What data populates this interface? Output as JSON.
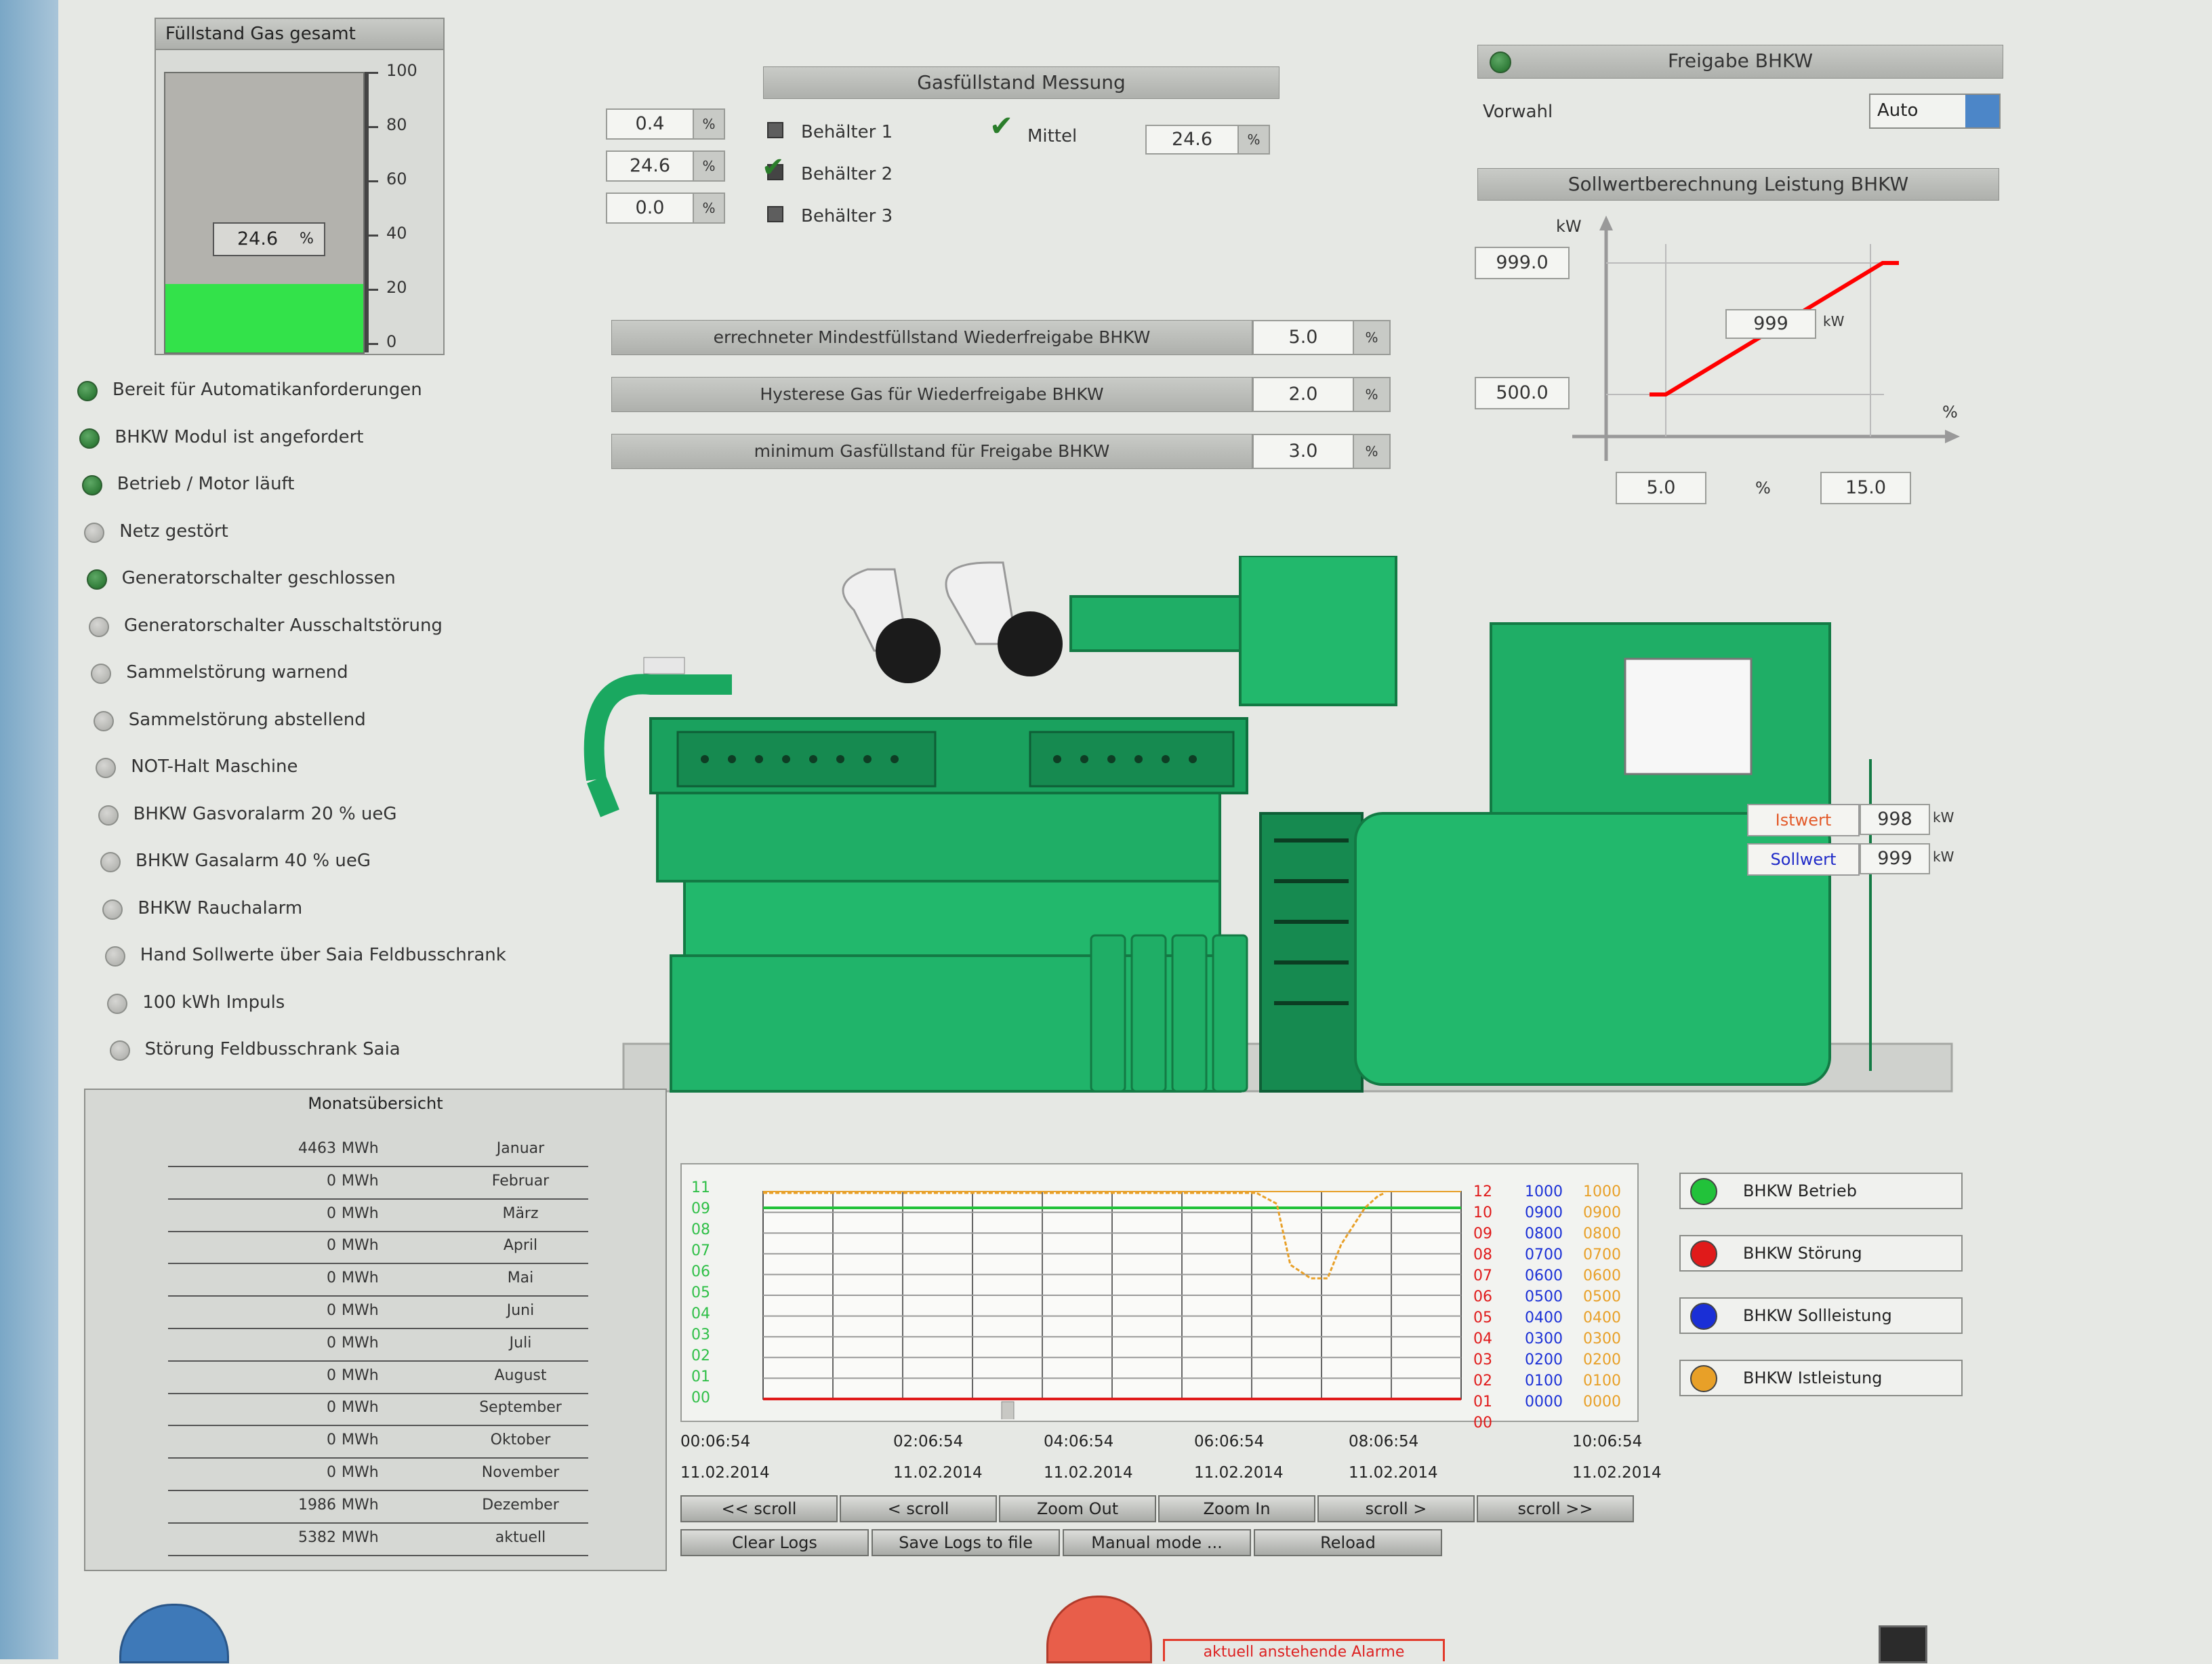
{
  "fill_panel": {
    "title": "Füllstand Gas gesamt",
    "value": "24.6",
    "unit": "%",
    "ticks": [
      "100",
      "80",
      "60",
      "40",
      "20",
      "0"
    ],
    "level": 0.246
  },
  "measurement": {
    "title": "Gasfüllstand Messung",
    "containers": [
      {
        "value": "0.4",
        "unit": "%",
        "label": "Behälter 1",
        "checked": false
      },
      {
        "value": "24.6",
        "unit": "%",
        "label": "Behälter 2",
        "checked": true
      },
      {
        "value": "0.0",
        "unit": "%",
        "label": "Behälter 3",
        "checked": false
      }
    ],
    "mittel_label": "Mittel",
    "mittel_value": "24.6",
    "mittel_unit": "%"
  },
  "settings": [
    {
      "label": "errechneter Mindestfüllstand Wiederfreigabe BHKW",
      "value": "5.0",
      "unit": "%"
    },
    {
      "label": "Hysterese Gas für Wiederfreigabe BHKW",
      "value": "2.0",
      "unit": "%"
    },
    {
      "label": "minimum Gasfüllstand für Freigabe BHKW",
      "value": "3.0",
      "unit": "%"
    }
  ],
  "freigabe": {
    "title": "Freigabe BHKW",
    "vorwahl_label": "Vorwahl",
    "vorwahl_value": "Auto"
  },
  "sollwert_calc": {
    "title": "Sollwertberechnung Leistung BHKW",
    "y_unit": "kW",
    "x_unit": "%",
    "y_high": "999.0",
    "y_low": "500.0",
    "current_value": "999",
    "current_unit": "kW",
    "x_low": "5.0",
    "x_mid_unit": "%",
    "x_high": "15.0"
  },
  "generator": {
    "istwert_label": "Istwert",
    "istwert_value": "998",
    "istwert_unit": "kW",
    "sollwert_label": "Sollwert",
    "sollwert_value": "999",
    "sollwert_unit": "kW"
  },
  "status": [
    {
      "label": "Bereit für Automatikanforderungen",
      "on": true
    },
    {
      "label": "BHKW Modul ist angefordert",
      "on": true
    },
    {
      "label": "Betrieb / Motor läuft",
      "on": true
    },
    {
      "label": "Netz gestört",
      "on": false
    },
    {
      "label": "Generatorschalter geschlossen",
      "on": true
    },
    {
      "label": "Generatorschalter Ausschaltstörung",
      "on": false
    },
    {
      "label": "Sammelstörung warnend",
      "on": false
    },
    {
      "label": "Sammelstörung abstellend",
      "on": false
    },
    {
      "label": "NOT-Halt Maschine",
      "on": false
    },
    {
      "label": "BHKW Gasvoralarm 20 % ueG",
      "on": false
    },
    {
      "label": "BHKW Gasalarm 40 % ueG",
      "on": false
    },
    {
      "label": "BHKW Rauchalarm",
      "on": false
    },
    {
      "label": "Hand Sollwerte über Saia Feldbusschrank",
      "on": false
    },
    {
      "label": "100 kWh Impuls",
      "on": false
    },
    {
      "label": "Störung Feldbusschrank Saia",
      "on": false
    }
  ],
  "monthly": {
    "title": "Monatsübersicht",
    "rows": [
      {
        "value": "4463",
        "unit": "MWh",
        "month": "Januar"
      },
      {
        "value": "0",
        "unit": "MWh",
        "month": "Februar"
      },
      {
        "value": "0",
        "unit": "MWh",
        "month": "März"
      },
      {
        "value": "0",
        "unit": "MWh",
        "month": "April"
      },
      {
        "value": "0",
        "unit": "MWh",
        "month": "Mai"
      },
      {
        "value": "0",
        "unit": "MWh",
        "month": "Juni"
      },
      {
        "value": "0",
        "unit": "MWh",
        "month": "Juli"
      },
      {
        "value": "0",
        "unit": "MWh",
        "month": "August"
      },
      {
        "value": "0",
        "unit": "MWh",
        "month": "September"
      },
      {
        "value": "0",
        "unit": "MWh",
        "month": "Oktober"
      },
      {
        "value": "0",
        "unit": "MWh",
        "month": "November"
      },
      {
        "value": "1986",
        "unit": "MWh",
        "month": "Dezember"
      },
      {
        "value": "5382",
        "unit": "MWh",
        "month": "aktuell"
      }
    ]
  },
  "trend": {
    "left_ticks": [
      "11",
      "09",
      "08",
      "07",
      "06",
      "05",
      "04",
      "03",
      "02",
      "01",
      "00"
    ],
    "red_ticks": [
      "12",
      "10",
      "09",
      "08",
      "07",
      "06",
      "05",
      "04",
      "03",
      "02",
      "01",
      "00"
    ],
    "blue_ticks": [
      "1000",
      "0900",
      "0800",
      "0700",
      "0600",
      "0500",
      "0400",
      "0300",
      "0200",
      "0100",
      "0000"
    ],
    "orange_ticks": [
      "1000",
      "0900",
      "0800",
      "0700",
      "0600",
      "0500",
      "0400",
      "0300",
      "0200",
      "0100",
      "0000"
    ],
    "time_labels": [
      {
        "time": "00:06:54",
        "date": "11.02.2014"
      },
      {
        "time": "02:06:54",
        "date": "11.02.2014"
      },
      {
        "time": "04:06:54",
        "date": "11.02.2014"
      },
      {
        "time": "06:06:54",
        "date": "11.02.2014"
      },
      {
        "time": "08:06:54",
        "date": "11.02.2014"
      },
      {
        "time": "10:06:54",
        "date": "11.02.2014"
      }
    ],
    "buttons_row1": [
      "<< scroll",
      "< scroll",
      "Zoom Out",
      "Zoom In",
      "scroll >",
      "scroll >>"
    ],
    "buttons_row2": [
      "Clear Logs",
      "Save Logs to file",
      "Manual mode ...",
      "Reload"
    ],
    "legend": [
      {
        "label": "BHKW Betrieb",
        "color": "#22c23a"
      },
      {
        "label": "BHKW Störung",
        "color": "#e01a1a"
      },
      {
        "label": "BHKW Sollleistung",
        "color": "#1a2fd6"
      },
      {
        "label": "BHKW Istleistung",
        "color": "#e8a028"
      }
    ]
  },
  "footer": {
    "alarm_text": "aktuell anstehende Alarme"
  }
}
